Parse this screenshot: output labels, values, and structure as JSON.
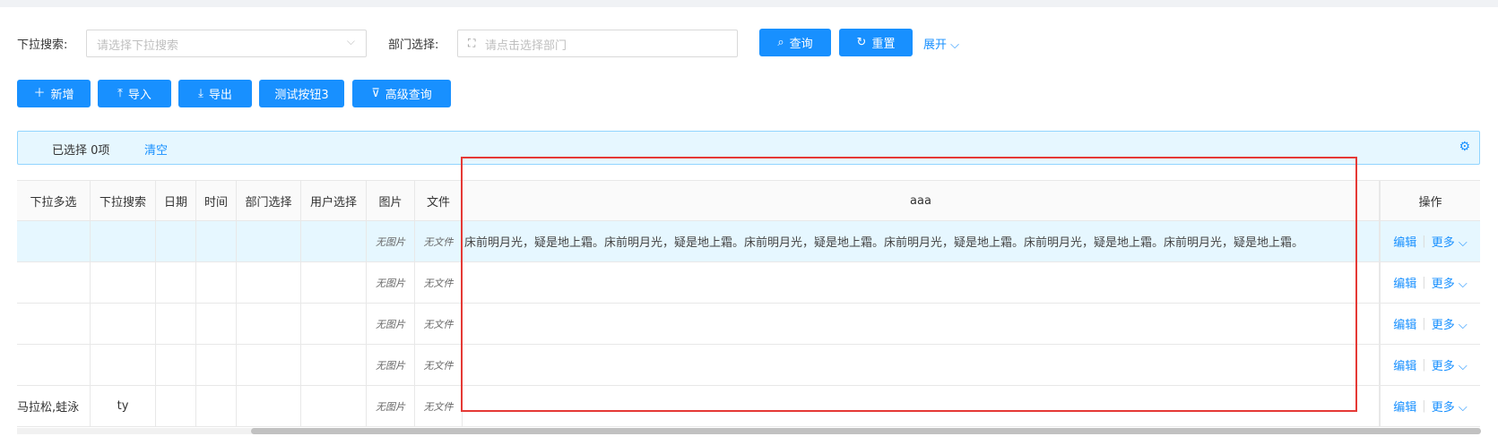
{
  "search": {
    "dropdown_label": "下拉搜索:",
    "dropdown_placeholder": "请选择下拉搜索",
    "dept_label": "部门选择:",
    "dept_placeholder": "请点击选择部门",
    "query_button": "查询",
    "reset_button": "重置",
    "expand_link": "展开"
  },
  "toolbar": {
    "add": "新增",
    "import": "导入",
    "export": "导出",
    "test": "测试按钮3",
    "advanced": "高级查询"
  },
  "selection": {
    "text": "已选择 0项",
    "clear": "清空"
  },
  "table": {
    "columns": [
      "下拉多选",
      "下拉搜索",
      "日期",
      "时间",
      "部门选择",
      "用户选择",
      "图片",
      "文件",
      "aaa",
      "操作"
    ],
    "no_image": "无图片",
    "no_file": "无文件",
    "aaa_text": "床前明月光，疑是地上霜。床前明月光，疑是地上霜。床前明月光，疑是地上霜。床前明月光，疑是地上霜。床前明月光，疑是地上霜。床前明月光，疑是地上霜。",
    "edit": "编辑",
    "more": "更多",
    "last_row": {
      "col1": "马拉松,蛙泳",
      "col2": "ty"
    }
  },
  "colors": {
    "primary": "#1890ff",
    "highlight": "#e53935"
  }
}
